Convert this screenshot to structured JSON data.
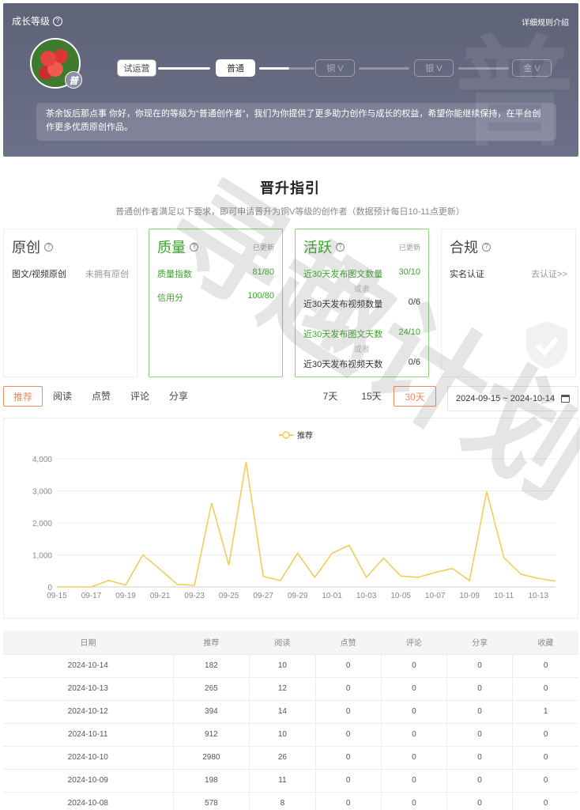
{
  "header": {
    "title": "成长等级",
    "rule_link": "详细规则介绍",
    "badge_char": "普",
    "big_char": "普",
    "levels": [
      {
        "label": "试运营",
        "state": "done"
      },
      {
        "label": "普通",
        "state": "current"
      },
      {
        "label": "铜 V",
        "state": "future"
      },
      {
        "label": "银 V",
        "state": "future"
      },
      {
        "label": "金 V",
        "state": "future"
      }
    ],
    "notice": "茶余饭后那点事 你好，你现在的等级为“普通创作者”，我们为你提供了更多助力创作与成长的权益，希望你能继续保持，在平台创作更多优质原创作品。"
  },
  "guide": {
    "title": "晋升指引",
    "subtitle": "普通创作者满足以下要求，即可申请晋升为铜V等级的创作者（数据预计每日10-11点更新）",
    "cards": [
      {
        "title": "原创",
        "status": "",
        "rows": [
          {
            "label": "图文/视频原创",
            "value": "未拥有原创"
          }
        ]
      },
      {
        "title": "质量",
        "status": "已更新",
        "rows": [
          {
            "label": "质量指数",
            "value": "81/80"
          },
          {
            "label": "信用分",
            "value": "100/80"
          }
        ]
      },
      {
        "title": "活跃",
        "status": "已更新",
        "or_text": "或者",
        "rows": [
          {
            "label": "近30天发布图文数量",
            "value": "30/10"
          },
          {
            "label": "近30天发布视频数量",
            "value": "0/6"
          },
          {
            "label": "近30天发布图文天数",
            "value": "24/10"
          },
          {
            "label": "近30天发布视频天数",
            "value": "0/6"
          }
        ]
      },
      {
        "title": "合规",
        "status": "",
        "rows": [
          {
            "label": "实名认证",
            "value": "去认证>>"
          }
        ]
      }
    ]
  },
  "tabs": {
    "metrics": [
      "推荐",
      "阅读",
      "点赞",
      "评论",
      "分享"
    ],
    "ranges": [
      "7天",
      "15天",
      "30天"
    ],
    "active_metric": "推荐",
    "active_range": "30天",
    "date_range": "2024-09-15 ~ 2024-10-14"
  },
  "chart_data": {
    "type": "line",
    "legend": "推荐",
    "legend_position": "top-center",
    "color": "#f2cd5a",
    "x": [
      "09-15",
      "09-16",
      "09-17",
      "09-18",
      "09-19",
      "09-20",
      "09-21",
      "09-22",
      "09-23",
      "09-24",
      "09-25",
      "09-26",
      "09-27",
      "09-28",
      "09-29",
      "09-30",
      "10-01",
      "10-02",
      "10-03",
      "10-04",
      "10-05",
      "10-06",
      "10-07",
      "10-08",
      "10-09",
      "10-10",
      "10-11",
      "10-12",
      "10-13",
      "10-14"
    ],
    "x_tick_labels": [
      "09-15",
      "09-17",
      "09-19",
      "09-21",
      "09-23",
      "09-25",
      "09-27",
      "09-29",
      "10-01",
      "10-03",
      "10-05",
      "10-07",
      "10-09",
      "10-11",
      "10-13"
    ],
    "values": [
      0,
      0,
      0,
      200,
      60,
      1000,
      550,
      80,
      50,
      2620,
      680,
      3900,
      330,
      200,
      1050,
      300,
      1050,
      1300,
      300,
      900,
      340,
      300,
      450,
      578,
      198,
      2980,
      912,
      394,
      265,
      182
    ],
    "ylim": [
      0,
      4000
    ],
    "y_ticks": [
      "0",
      "1,000",
      "2,000",
      "3,000",
      "4,000"
    ],
    "grid": true
  },
  "table": {
    "headers": [
      "日期",
      "推荐",
      "阅读",
      "点赞",
      "评论",
      "分享",
      "收藏"
    ],
    "rows": [
      [
        "2024-10-14",
        "182",
        "10",
        "0",
        "0",
        "0",
        "0"
      ],
      [
        "2024-10-13",
        "265",
        "12",
        "0",
        "0",
        "0",
        "0"
      ],
      [
        "2024-10-12",
        "394",
        "14",
        "0",
        "0",
        "0",
        "1"
      ],
      [
        "2024-10-11",
        "912",
        "10",
        "0",
        "0",
        "0",
        "0"
      ],
      [
        "2024-10-10",
        "2980",
        "26",
        "0",
        "0",
        "0",
        "0"
      ],
      [
        "2024-10-09",
        "198",
        "11",
        "0",
        "0",
        "0",
        "0"
      ],
      [
        "2024-10-08",
        "578",
        "8",
        "0",
        "0",
        "0",
        "0"
      ]
    ]
  },
  "watermark": "寻趣计划"
}
